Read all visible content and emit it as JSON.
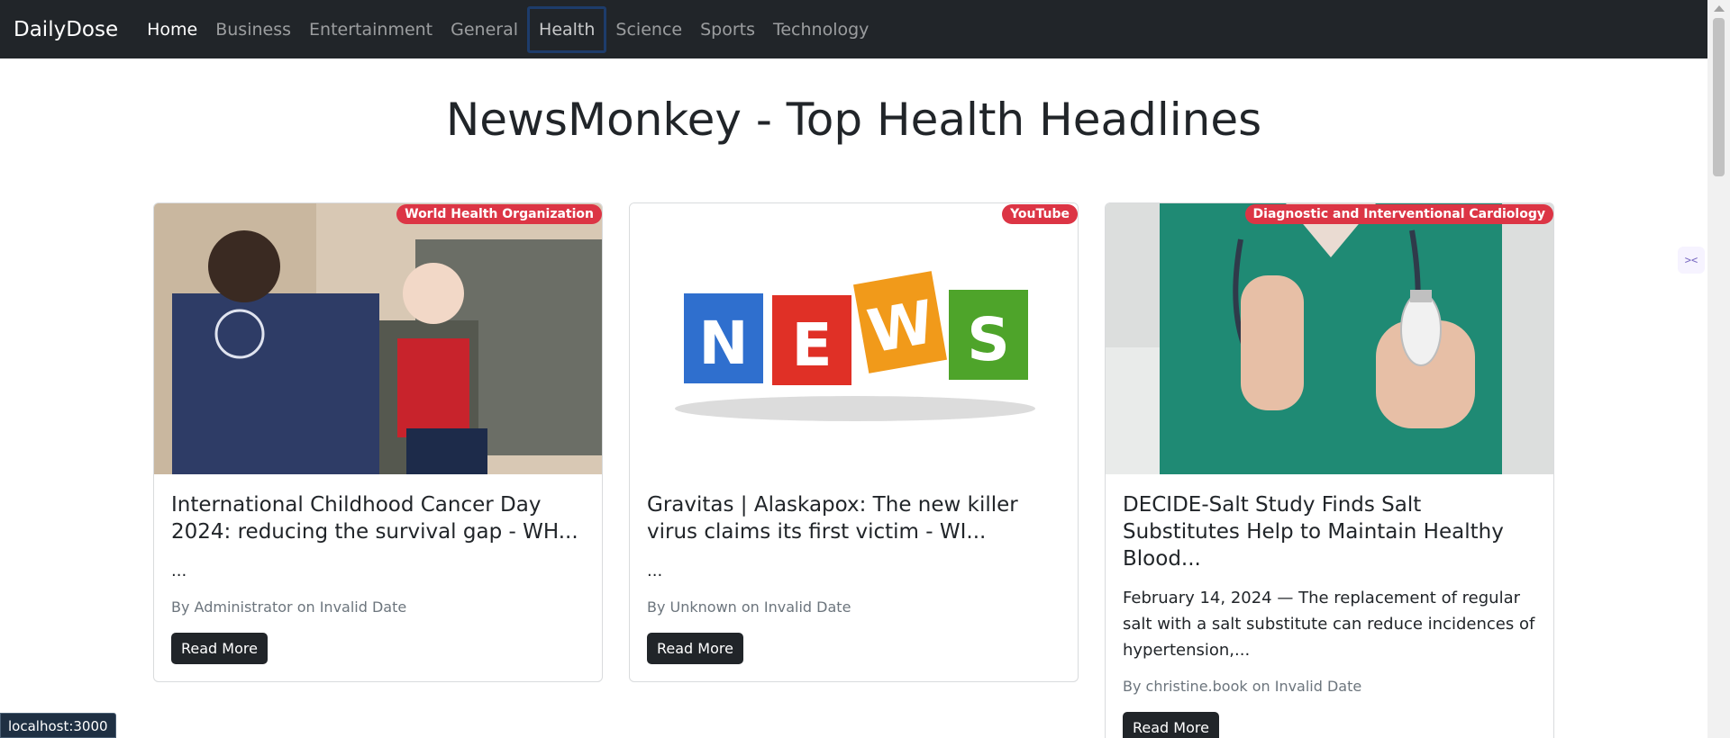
{
  "nav": {
    "brand": "DailyDose",
    "links": [
      "Home",
      "Business",
      "Entertainment",
      "General",
      "Health",
      "Science",
      "Sports",
      "Technology"
    ]
  },
  "page_title": "NewsMonkey - Top Health Headlines",
  "side_widget_icon": "code-icon",
  "cards": [
    {
      "badge": "World Health Organization",
      "image_icon": "who-photo",
      "title": "International Childhood Cancer Day 2024: reducing the survival gap - WH...",
      "description": "...",
      "meta": "By Administrator on Invalid Date",
      "button": "Read More"
    },
    {
      "badge": "YouTube",
      "image_icon": "news-blocks-photo",
      "image_letters": [
        "N",
        "E",
        "W",
        "S"
      ],
      "title": "Gravitas | Alaskapox: The new killer virus claims its first victim - WI...",
      "description": "...",
      "meta": "By Unknown on Invalid Date",
      "button": "Read More"
    },
    {
      "badge": "Diagnostic and Interventional Cardiology",
      "image_icon": "doctor-salt-photo",
      "title": "DECIDE-Salt Study Finds Salt Substitutes Help to Maintain Healthy Blood...",
      "description": "February 14, 2024 — The replacement of regular salt with a salt substitute can reduce incidences of hypertension,...",
      "meta": "By christine.book on Invalid Date",
      "button": "Read More"
    }
  ],
  "status_bar": "localhost:3000",
  "colors": {
    "navbar": "#212529",
    "badge": "#dc3545",
    "button": "#212529"
  }
}
